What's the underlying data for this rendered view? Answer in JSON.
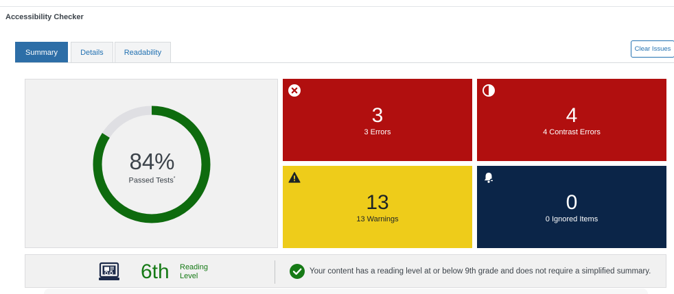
{
  "panel": {
    "title": "Accessibility Checker"
  },
  "tabs": [
    {
      "label": "Summary"
    },
    {
      "label": "Details"
    },
    {
      "label": "Readability"
    }
  ],
  "actions": {
    "clear_label": "Clear Issues"
  },
  "summary": {
    "percent_text": "84%",
    "percent_value": 84,
    "label": "Passed Tests",
    "footnote_mark": "*"
  },
  "tiles": {
    "errors": {
      "count": "3",
      "label": "3 Errors",
      "icon": "error-x-icon",
      "color": "#b10f0f"
    },
    "contrast": {
      "count": "4",
      "label": "4 Contrast Errors",
      "icon": "contrast-icon",
      "color": "#b10f0f"
    },
    "warnings": {
      "count": "13",
      "label": "13 Warnings",
      "icon": "warning-icon",
      "color": "#eecc1a"
    },
    "ignored": {
      "count": "0",
      "label": "0 Ignored Items",
      "icon": "bell-icon",
      "color": "#0b2548"
    }
  },
  "readability": {
    "grade": "6th",
    "label_line1": "Reading",
    "label_line2": "Level",
    "message": "Your content has a reading level at or below 9th grade and does not require a simplified summary.",
    "accent_color": "#167a16"
  },
  "colors": {
    "primary": "#2d6ea7",
    "link": "#2271b1",
    "pass": "#167a16"
  }
}
